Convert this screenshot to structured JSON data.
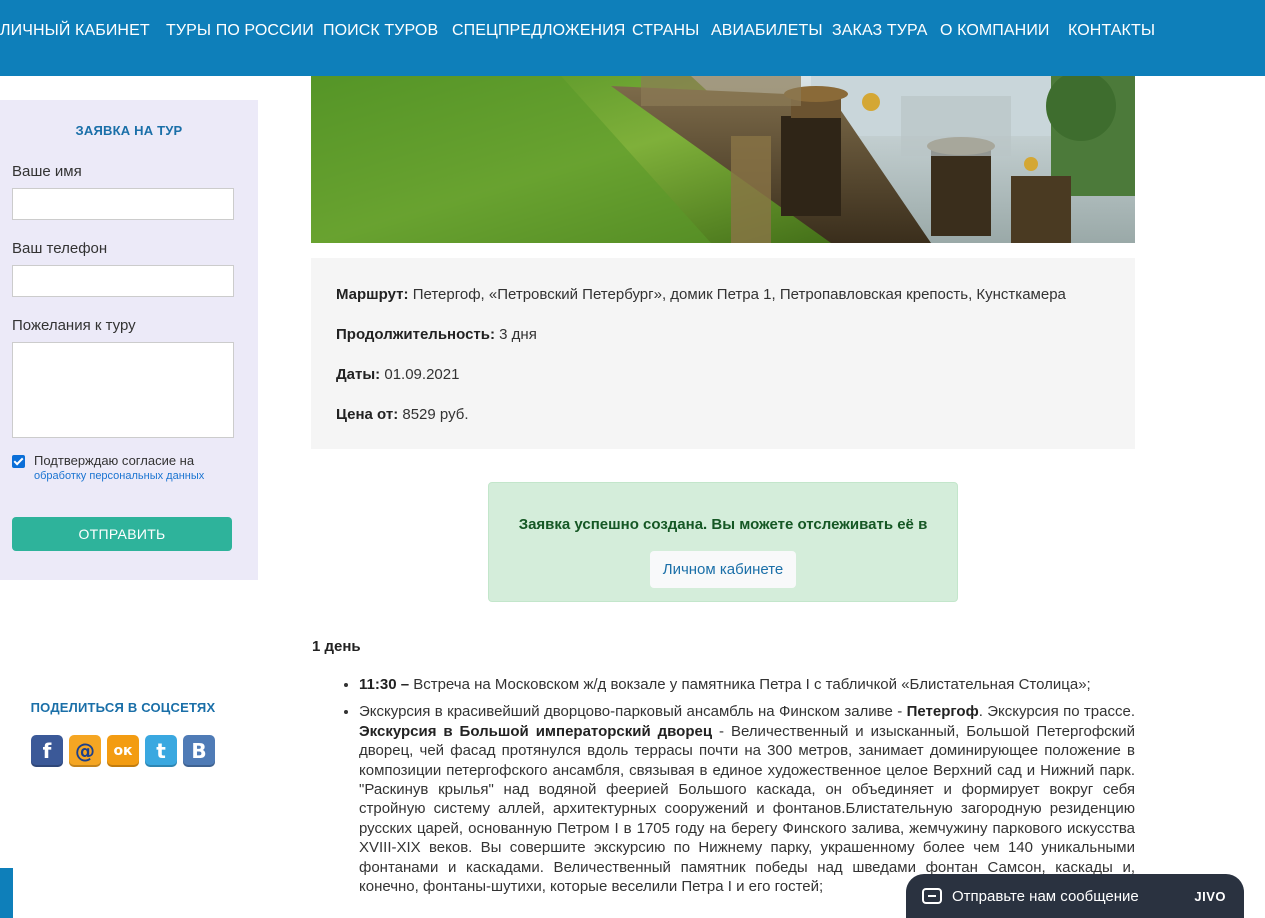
{
  "nav": {
    "items": [
      {
        "label": "ЛИЧНЫЙ КАБИНЕТ",
        "x": 0
      },
      {
        "label": "ТУРЫ ПО РОССИИ"
      },
      {
        "label": "ПОИСК ТУРОВ"
      },
      {
        "label": "СПЕЦПРЕДЛОЖЕНИЯ"
      },
      {
        "label": "СТРАНЫ"
      },
      {
        "label": "АВИАБИЛЕТЫ"
      },
      {
        "label": "ЗАКАЗ ТУРА"
      },
      {
        "label": "О КОМПАНИИ"
      },
      {
        "label": "КОНТАКТЫ"
      }
    ],
    "color": "#0e7fba"
  },
  "form": {
    "title": "ЗАЯВКА НА ТУР",
    "name_label": "Ваше имя",
    "name_value": "",
    "phone_label": "Ваш телефон",
    "phone_value": "",
    "wishes_label": "Пожелания к туру",
    "wishes_value": "",
    "consent_checked": true,
    "consent_text": "Подтверждаю согласие на",
    "consent_link": "обработку персональных данных",
    "submit_label": "ОТПРАВИТЬ"
  },
  "share": {
    "title": "ПОДЕЛИТЬСЯ В СОЦСЕТЯХ",
    "icons": [
      {
        "name": "facebook-icon",
        "glyph": "f"
      },
      {
        "name": "mail-ru-icon",
        "glyph": "@"
      },
      {
        "name": "odnoklassniki-icon",
        "glyph": "ок"
      },
      {
        "name": "twitter-icon",
        "glyph": "t"
      },
      {
        "name": "vkontakte-icon",
        "glyph": "B"
      }
    ]
  },
  "tour": {
    "route_label": "Маршрут:",
    "route_value": "Петергоф, «Петровский Петербург», домик Петра 1, Петропавловская крепость, Кунсткамера",
    "duration_label": "Продолжительность:",
    "duration_value": "3 дня",
    "dates_label": "Даты:",
    "dates_value": "01.09.2021",
    "price_label": "Цена от:",
    "price_value": "8529 руб."
  },
  "alert": {
    "message": "Заявка успешно создана. Вы можете отслеживать её в",
    "button_label": "Личном кабинете"
  },
  "itinerary": {
    "day_title": "1 день",
    "item1_time": "11:30 –",
    "item1_text": "Встреча на Московском ж/д вокзале у памятника Петра I с табличкой «Блистательная Столица»;",
    "item2_a": "Экскурсия в красивейший дворцово-парковый ансамбль на Финском заливе - ",
    "item2_b": "Петергоф",
    "item2_c": ". Экскурсия по трассе. ",
    "item2_d": "Экскурсия в Большой императорский дворец",
    "item2_e": " - Величественный и изысканный, Большой Петергофский дворец, чей фасад протянулся вдоль террасы почти на 300 метров, занимает доминирующее положение в композиции петергофского ансамбля, связывая в единое художественное целое Верхний сад и Нижний парк. \"Раскинув крылья\" над водяной феерией Большого каскада, он объединяет и формирует вокруг себя стройную систему аллей, архитектурных сооружений и фонтанов.Блистательную загородную резиденцию русских царей, основанную Петром I в 1705 году на берегу Финского залива, жемчужину паркового искусства XVIII-XIX веков. Вы совершите экскурсию по Нижнему парку, украшенному более чем 140 уникальными фонтанами и каскадами. Величественный памятник победы над шведами фонтан Самсон, каскады и, конечно, фонтаны-шутихи, которые веселили Петра I и его гостей;"
  },
  "chat": {
    "text": "Отправьте нам сообщение",
    "brand": "JIVO"
  }
}
